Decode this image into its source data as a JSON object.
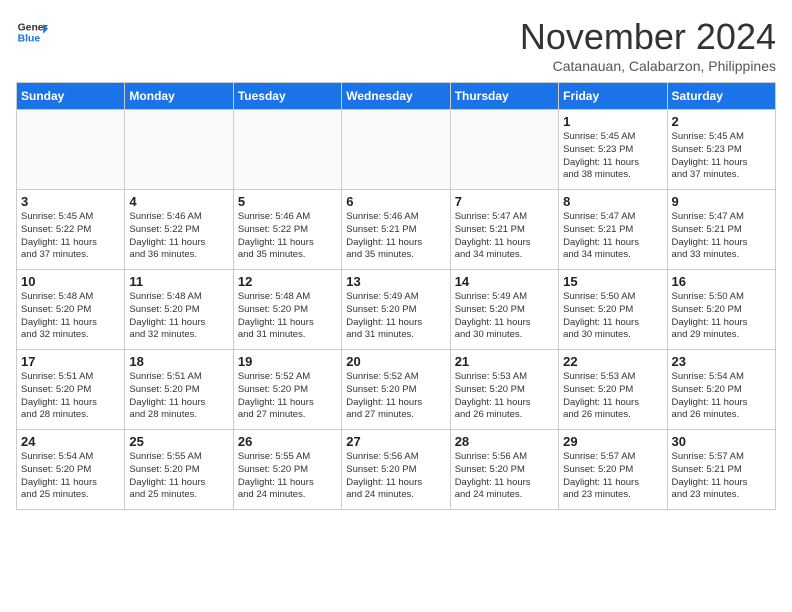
{
  "header": {
    "logo_general": "General",
    "logo_blue": "Blue",
    "month_title": "November 2024",
    "location": "Catanauan, Calabarzon, Philippines"
  },
  "weekdays": [
    "Sunday",
    "Monday",
    "Tuesday",
    "Wednesday",
    "Thursday",
    "Friday",
    "Saturday"
  ],
  "weeks": [
    [
      {
        "day": "",
        "info": ""
      },
      {
        "day": "",
        "info": ""
      },
      {
        "day": "",
        "info": ""
      },
      {
        "day": "",
        "info": ""
      },
      {
        "day": "",
        "info": ""
      },
      {
        "day": "1",
        "info": "Sunrise: 5:45 AM\nSunset: 5:23 PM\nDaylight: 11 hours\nand 38 minutes."
      },
      {
        "day": "2",
        "info": "Sunrise: 5:45 AM\nSunset: 5:23 PM\nDaylight: 11 hours\nand 37 minutes."
      }
    ],
    [
      {
        "day": "3",
        "info": "Sunrise: 5:45 AM\nSunset: 5:22 PM\nDaylight: 11 hours\nand 37 minutes."
      },
      {
        "day": "4",
        "info": "Sunrise: 5:46 AM\nSunset: 5:22 PM\nDaylight: 11 hours\nand 36 minutes."
      },
      {
        "day": "5",
        "info": "Sunrise: 5:46 AM\nSunset: 5:22 PM\nDaylight: 11 hours\nand 35 minutes."
      },
      {
        "day": "6",
        "info": "Sunrise: 5:46 AM\nSunset: 5:21 PM\nDaylight: 11 hours\nand 35 minutes."
      },
      {
        "day": "7",
        "info": "Sunrise: 5:47 AM\nSunset: 5:21 PM\nDaylight: 11 hours\nand 34 minutes."
      },
      {
        "day": "8",
        "info": "Sunrise: 5:47 AM\nSunset: 5:21 PM\nDaylight: 11 hours\nand 34 minutes."
      },
      {
        "day": "9",
        "info": "Sunrise: 5:47 AM\nSunset: 5:21 PM\nDaylight: 11 hours\nand 33 minutes."
      }
    ],
    [
      {
        "day": "10",
        "info": "Sunrise: 5:48 AM\nSunset: 5:20 PM\nDaylight: 11 hours\nand 32 minutes."
      },
      {
        "day": "11",
        "info": "Sunrise: 5:48 AM\nSunset: 5:20 PM\nDaylight: 11 hours\nand 32 minutes."
      },
      {
        "day": "12",
        "info": "Sunrise: 5:48 AM\nSunset: 5:20 PM\nDaylight: 11 hours\nand 31 minutes."
      },
      {
        "day": "13",
        "info": "Sunrise: 5:49 AM\nSunset: 5:20 PM\nDaylight: 11 hours\nand 31 minutes."
      },
      {
        "day": "14",
        "info": "Sunrise: 5:49 AM\nSunset: 5:20 PM\nDaylight: 11 hours\nand 30 minutes."
      },
      {
        "day": "15",
        "info": "Sunrise: 5:50 AM\nSunset: 5:20 PM\nDaylight: 11 hours\nand 30 minutes."
      },
      {
        "day": "16",
        "info": "Sunrise: 5:50 AM\nSunset: 5:20 PM\nDaylight: 11 hours\nand 29 minutes."
      }
    ],
    [
      {
        "day": "17",
        "info": "Sunrise: 5:51 AM\nSunset: 5:20 PM\nDaylight: 11 hours\nand 28 minutes."
      },
      {
        "day": "18",
        "info": "Sunrise: 5:51 AM\nSunset: 5:20 PM\nDaylight: 11 hours\nand 28 minutes."
      },
      {
        "day": "19",
        "info": "Sunrise: 5:52 AM\nSunset: 5:20 PM\nDaylight: 11 hours\nand 27 minutes."
      },
      {
        "day": "20",
        "info": "Sunrise: 5:52 AM\nSunset: 5:20 PM\nDaylight: 11 hours\nand 27 minutes."
      },
      {
        "day": "21",
        "info": "Sunrise: 5:53 AM\nSunset: 5:20 PM\nDaylight: 11 hours\nand 26 minutes."
      },
      {
        "day": "22",
        "info": "Sunrise: 5:53 AM\nSunset: 5:20 PM\nDaylight: 11 hours\nand 26 minutes."
      },
      {
        "day": "23",
        "info": "Sunrise: 5:54 AM\nSunset: 5:20 PM\nDaylight: 11 hours\nand 26 minutes."
      }
    ],
    [
      {
        "day": "24",
        "info": "Sunrise: 5:54 AM\nSunset: 5:20 PM\nDaylight: 11 hours\nand 25 minutes."
      },
      {
        "day": "25",
        "info": "Sunrise: 5:55 AM\nSunset: 5:20 PM\nDaylight: 11 hours\nand 25 minutes."
      },
      {
        "day": "26",
        "info": "Sunrise: 5:55 AM\nSunset: 5:20 PM\nDaylight: 11 hours\nand 24 minutes."
      },
      {
        "day": "27",
        "info": "Sunrise: 5:56 AM\nSunset: 5:20 PM\nDaylight: 11 hours\nand 24 minutes."
      },
      {
        "day": "28",
        "info": "Sunrise: 5:56 AM\nSunset: 5:20 PM\nDaylight: 11 hours\nand 24 minutes."
      },
      {
        "day": "29",
        "info": "Sunrise: 5:57 AM\nSunset: 5:20 PM\nDaylight: 11 hours\nand 23 minutes."
      },
      {
        "day": "30",
        "info": "Sunrise: 5:57 AM\nSunset: 5:21 PM\nDaylight: 11 hours\nand 23 minutes."
      }
    ]
  ]
}
